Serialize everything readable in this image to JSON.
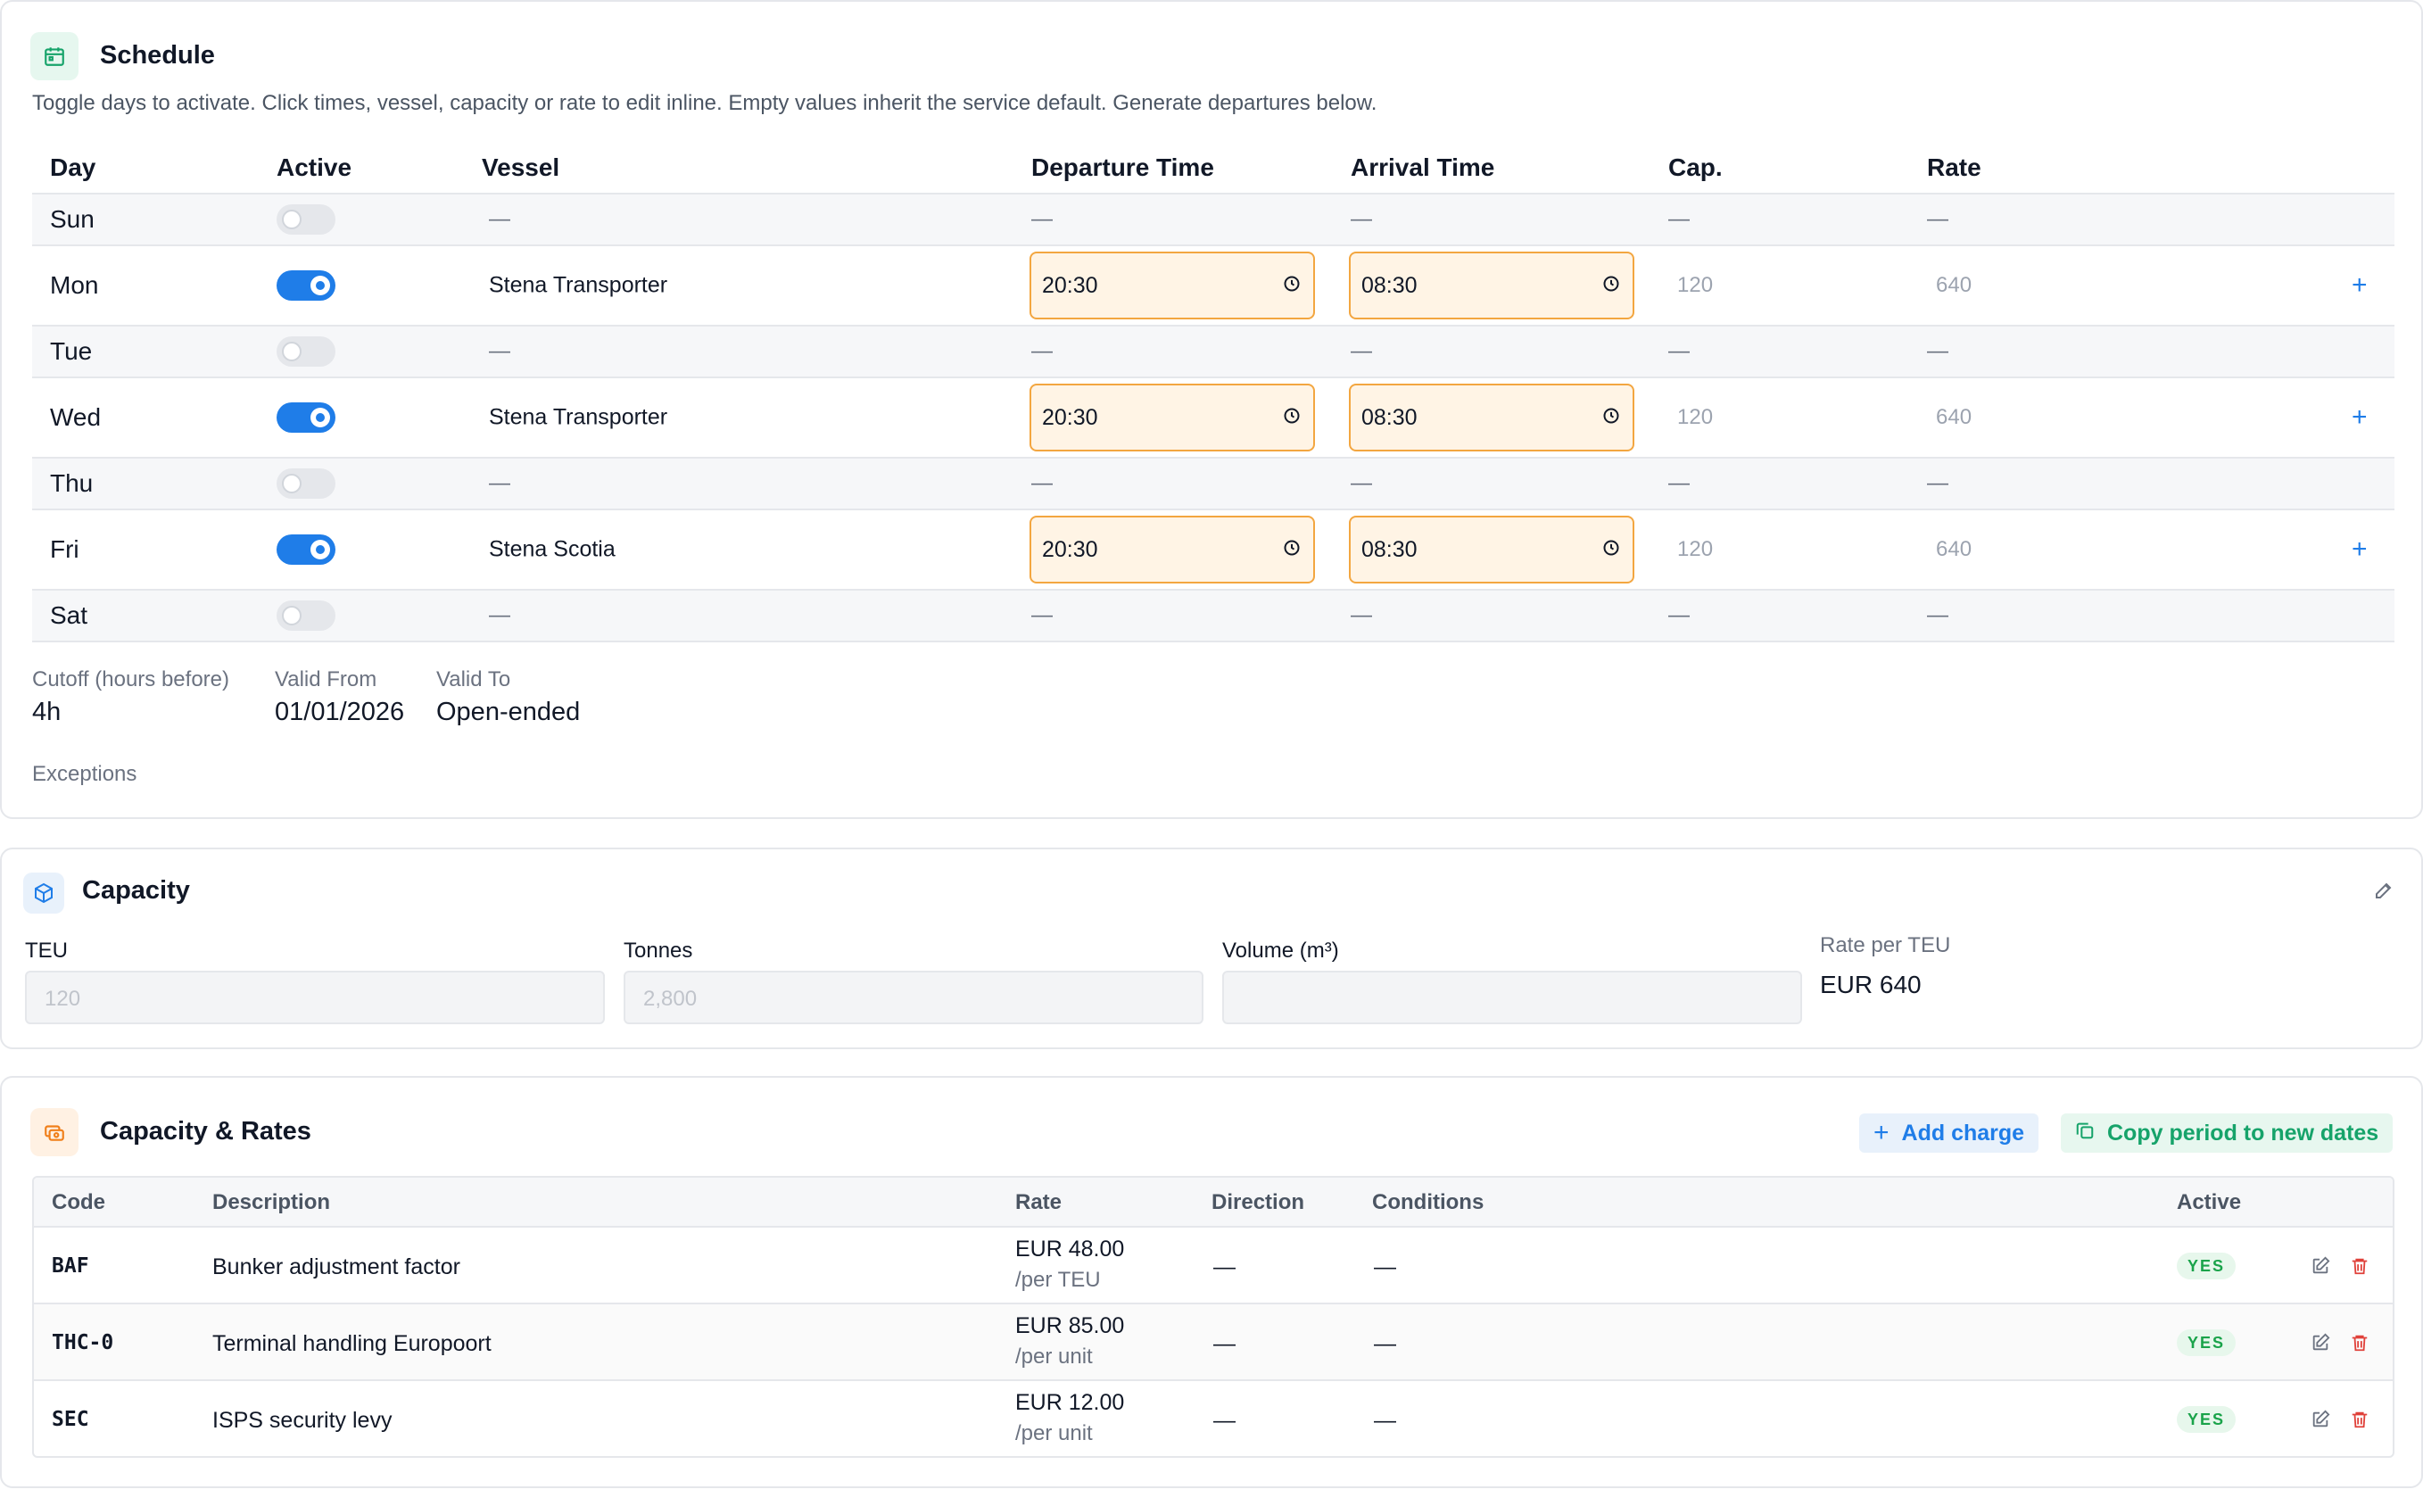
{
  "schedule": {
    "title": "Schedule",
    "subtitle": "Toggle days to activate. Click times, vessel, capacity or rate to edit inline. Empty values inherit the service default. Generate departures below.",
    "columns": {
      "day": "Day",
      "active": "Active",
      "vessel": "Vessel",
      "departure": "Departure Time",
      "arrival": "Arrival Time",
      "cap": "Cap.",
      "rate": "Rate"
    },
    "dash": "—",
    "rows": [
      {
        "day": "Sun",
        "active": false
      },
      {
        "day": "Mon",
        "active": true,
        "vessel": "Stena Transporter",
        "departure": "20:30",
        "arrival": "08:30",
        "cap": "120",
        "rate": "640",
        "plus": "+"
      },
      {
        "day": "Tue",
        "active": false
      },
      {
        "day": "Wed",
        "active": true,
        "vessel": "Stena Transporter",
        "departure": "20:30",
        "arrival": "08:30",
        "cap": "120",
        "rate": "640",
        "plus": "+"
      },
      {
        "day": "Thu",
        "active": false
      },
      {
        "day": "Fri",
        "active": true,
        "vessel": "Stena Scotia",
        "departure": "20:30",
        "arrival": "08:30",
        "cap": "120",
        "rate": "640",
        "plus": "+"
      },
      {
        "day": "Sat",
        "active": false
      }
    ],
    "cutoff_label": "Cutoff (hours before)",
    "cutoff_value": "4h",
    "valid_from_label": "Valid From",
    "valid_from_value": "01/01/2026",
    "valid_to_label": "Valid To",
    "valid_to_value": "Open-ended",
    "exceptions_label": "Exceptions"
  },
  "capacity": {
    "title": "Capacity",
    "teu_label": "TEU",
    "teu_placeholder": "120",
    "tonnes_label": "Tonnes",
    "tonnes_placeholder": "2,800",
    "volume_label": "Volume (m³)",
    "volume_placeholder": "",
    "rate_label": "Rate per TEU",
    "rate_value": "EUR 640"
  },
  "rates": {
    "title": "Capacity & Rates",
    "add_charge": "Add charge",
    "copy_period": "Copy period to new dates",
    "columns": {
      "code": "Code",
      "description": "Description",
      "rate": "Rate",
      "direction": "Direction",
      "conditions": "Conditions",
      "active": "Active"
    },
    "rows": [
      {
        "code": "BAF",
        "description": "Bunker adjustment factor",
        "rate": "EUR 48.00",
        "unit": "/per TEU",
        "direction": "—",
        "conditions": "—",
        "active": "YES"
      },
      {
        "code": "THC-0",
        "description": "Terminal handling Europoort",
        "rate": "EUR 85.00",
        "unit": "/per unit",
        "direction": "—",
        "conditions": "—",
        "active": "YES"
      },
      {
        "code": "SEC",
        "description": "ISPS security levy",
        "rate": "EUR 12.00",
        "unit": "/per unit",
        "direction": "—",
        "conditions": "—",
        "active": "YES"
      }
    ]
  },
  "colors": {
    "accent_blue": "#1f7de8",
    "time_border": "#f3a640",
    "time_fill": "#fff4e5",
    "green": "#1aa34a",
    "red": "#e0413a"
  },
  "icons": {
    "schedule": "calendar-icon",
    "capacity": "box-icon",
    "rates": "coins-icon",
    "time": "clock-icon",
    "edit": "pencil-icon",
    "delete": "trash-icon"
  }
}
